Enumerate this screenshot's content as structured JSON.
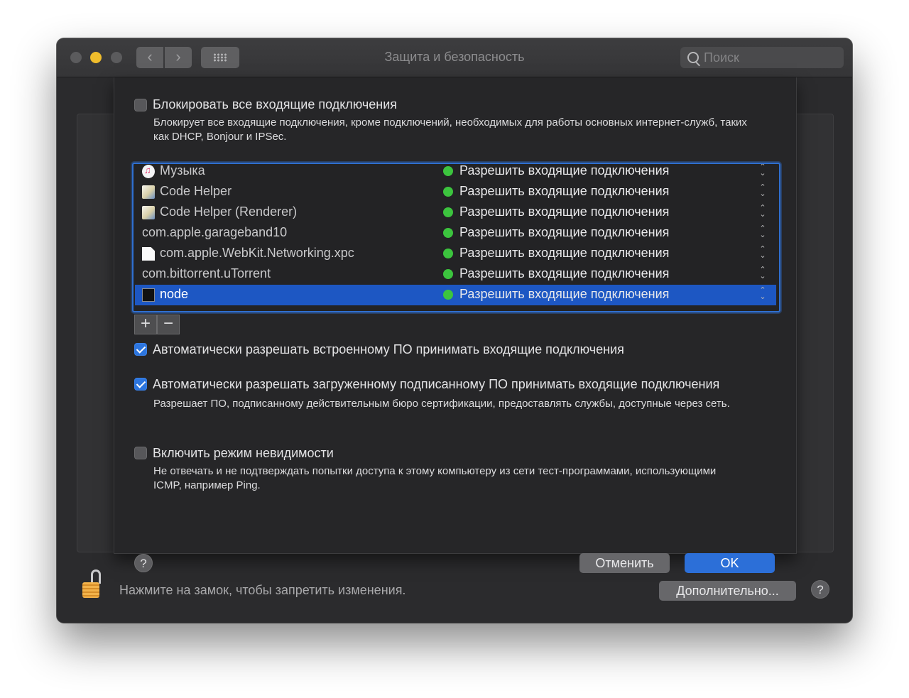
{
  "window": {
    "title": "Защита и безопасность",
    "search_placeholder": "Поиск"
  },
  "sheet": {
    "block_all": {
      "label": "Блокировать все входящие подключения",
      "checked": false,
      "description": "Блокирует все входящие подключения, кроме подключений, необходимых для работы основных интернет-служб, таких как DHCP, Bonjour и IPSec."
    },
    "apps": [
      {
        "name": "Музыка",
        "icon": "music-icon",
        "status": "Разрешить входящие подключения",
        "selected": false
      },
      {
        "name": "Code Helper",
        "icon": "code-helper-icon",
        "status": "Разрешить входящие подключения",
        "selected": false
      },
      {
        "name": "Code Helper (Renderer)",
        "icon": "code-helper-icon",
        "status": "Разрешить входящие подключения",
        "selected": false
      },
      {
        "name": "com.apple.garageband10",
        "icon": "",
        "status": "Разрешить входящие подключения",
        "selected": false
      },
      {
        "name": "com.apple.WebKit.Networking.xpc",
        "icon": "document-icon",
        "status": "Разрешить входящие подключения",
        "selected": false
      },
      {
        "name": "com.bittorrent.uTorrent",
        "icon": "",
        "status": "Разрешить входящие подключения",
        "selected": false
      },
      {
        "name": "node",
        "icon": "terminal-icon",
        "status": "Разрешить входящие подключения",
        "selected": true
      }
    ],
    "add_label": "+",
    "remove_label": "−",
    "auto_builtin": {
      "label": "Автоматически разрешать встроенному ПО принимать входящие подключения",
      "checked": true
    },
    "auto_signed": {
      "label": "Автоматически разрешать загруженному подписанному ПО принимать входящие подключения",
      "checked": true,
      "description": "Разрешает ПО, подписанному действительным бюро сертификации, предоставлять службы, доступные через сеть."
    },
    "stealth": {
      "label": "Включить режим невидимости",
      "checked": false,
      "description": "Не отвечать и не подтверждать попытки доступа к этому компьютеру из сети тест-программами, использующими ICMP, например Ping."
    },
    "help_label": "?",
    "cancel_label": "Отменить",
    "ok_label": "OK"
  },
  "footer": {
    "lock_text": "Нажмите на замок, чтобы запретить изменения.",
    "advanced_label": "Дополнительно...",
    "help_label": "?"
  },
  "colors": {
    "accent": "#2c6fd8",
    "status_green": "#3cc43e",
    "minimize_yellow": "#f0bd2c"
  }
}
